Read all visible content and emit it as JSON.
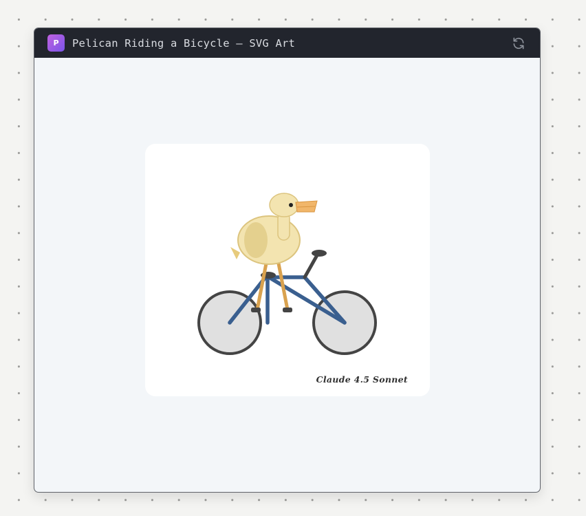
{
  "window": {
    "app_icon_letter": "P",
    "title": "Pelican Riding a Bicycle — SVG Art",
    "refresh_icon": "refresh-icon"
  },
  "artwork": {
    "signature": "Claude 4.5 Sonnet",
    "colors": {
      "frame": "#3a5f8f",
      "wheel_fill": "#e0e0e0",
      "wheel_stroke": "#444444",
      "body": "#f3e4b0",
      "body_outline": "#dcc47e",
      "wing": "#e4d08e",
      "beak": "#f1b66a",
      "legs": "#d9a24f",
      "eye": "#222222"
    }
  }
}
